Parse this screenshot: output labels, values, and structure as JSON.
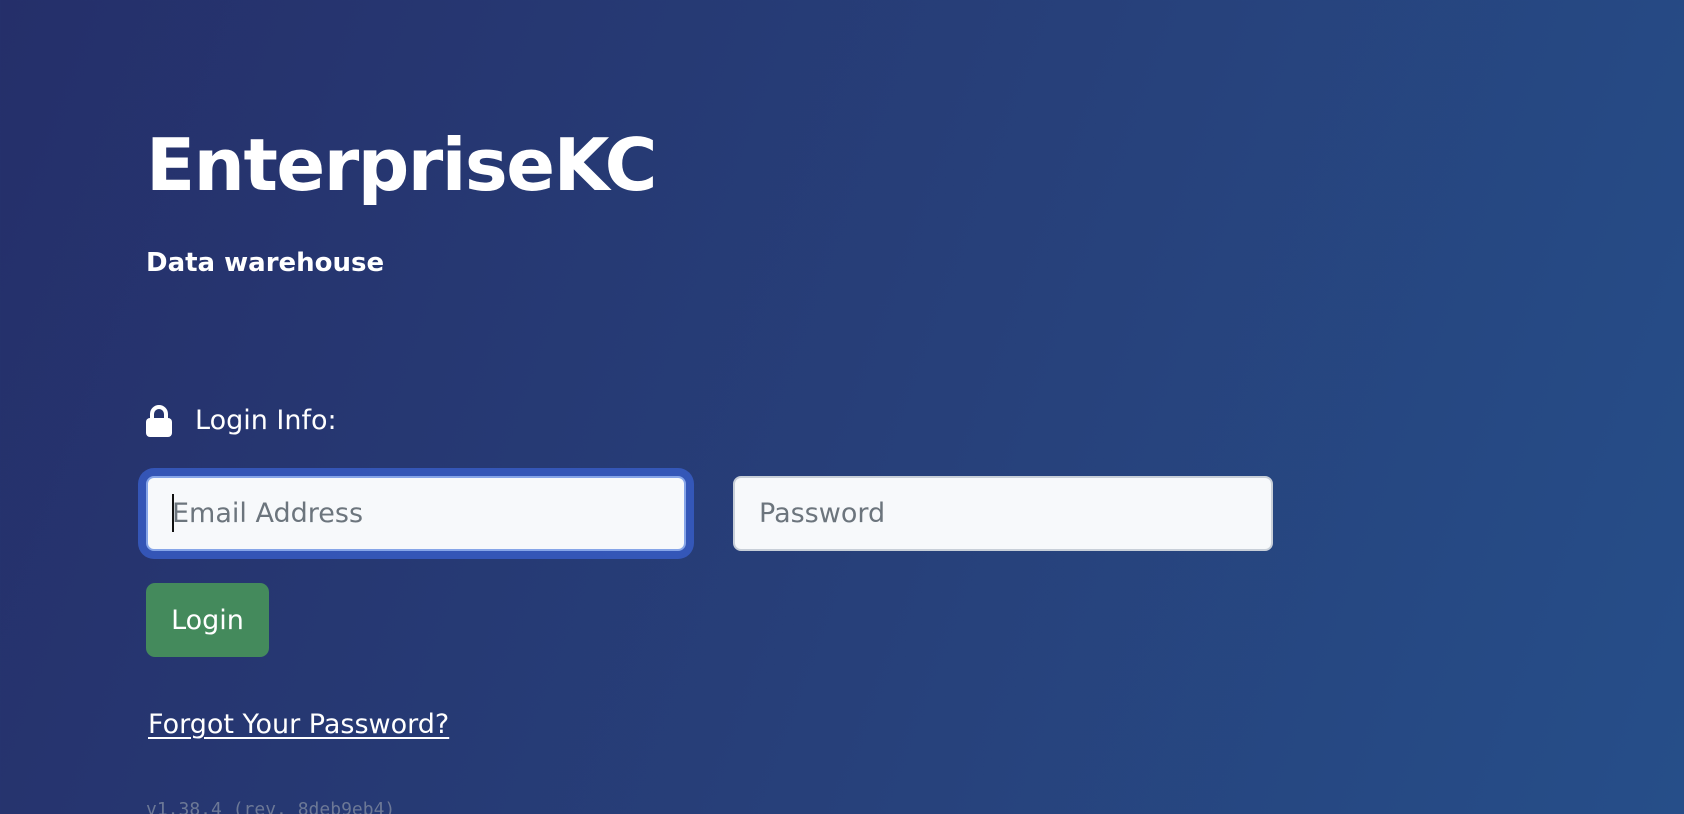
{
  "app": {
    "title": "EnterpriseKC",
    "subtitle": "Data warehouse"
  },
  "login": {
    "heading": "Login Info:",
    "heading_icon": "lock-icon",
    "email_placeholder": "Email Address",
    "email_value": "",
    "password_placeholder": "Password",
    "password_value": "",
    "submit_label": "Login",
    "forgot_label": "Forgot Your Password?"
  },
  "footer": {
    "version": "v1.38.4 (rev. 8deb9eb4)"
  },
  "colors": {
    "background_start": "#252f6a",
    "background_end": "#264e89",
    "login_button": "#448a5c",
    "focus_ring": "#3a60cd",
    "text": "#ffffff"
  }
}
